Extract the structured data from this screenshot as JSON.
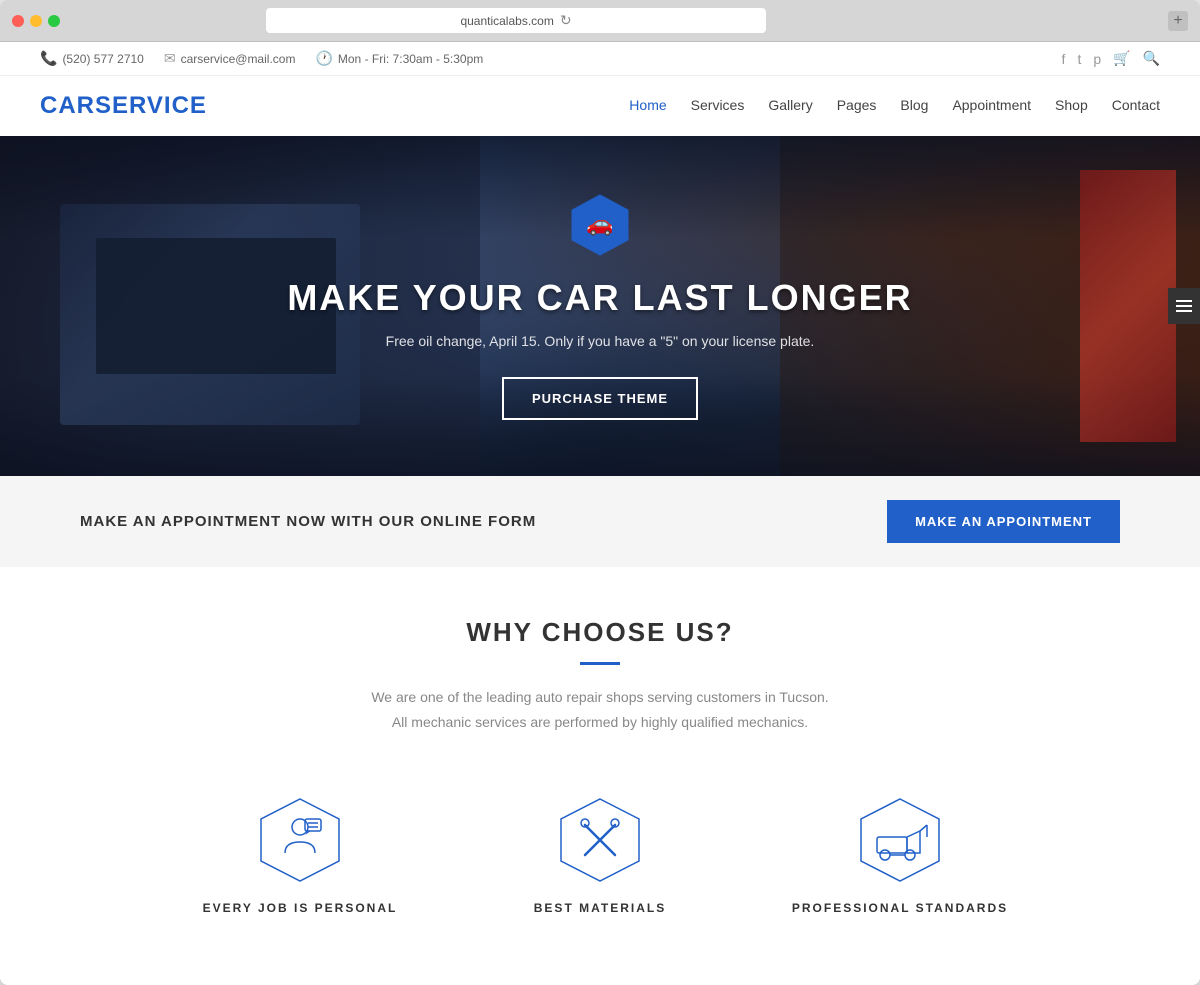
{
  "browser": {
    "url": "quanticalabs.com",
    "new_tab_label": "+"
  },
  "topbar": {
    "phone": "(520) 577 2710",
    "email": "carservice@mail.com",
    "hours": "Mon - Fri: 7:30am - 5:30pm"
  },
  "navbar": {
    "logo": "CARSERVICE",
    "links": [
      {
        "label": "Home",
        "active": true
      },
      {
        "label": "Services",
        "active": false
      },
      {
        "label": "Gallery",
        "active": false
      },
      {
        "label": "Pages",
        "active": false
      },
      {
        "label": "Blog",
        "active": false
      },
      {
        "label": "Appointment",
        "active": false
      },
      {
        "label": "Shop",
        "active": false
      },
      {
        "label": "Contact",
        "active": false
      }
    ]
  },
  "hero": {
    "title": "MAKE YOUR CAR LAST LONGER",
    "subtitle": "Free oil change, April 15. Only if you have a \"5\" on your license plate.",
    "cta_label": "PURCHASE THEME"
  },
  "appointment_banner": {
    "text": "MAKE AN APPOINTMENT NOW WITH OUR ONLINE FORM",
    "button_label": "MAKE AN APPOINTMENT"
  },
  "why_section": {
    "title": "WHY CHOOSE US?",
    "description_line1": "We are one of the leading auto repair shops serving customers in Tucson.",
    "description_line2": "All mechanic services are performed by highly qualified mechanics.",
    "features": [
      {
        "label": "EVERY JOB IS PERSONAL",
        "icon": "person-chat"
      },
      {
        "label": "BEST MATERIALS",
        "icon": "tools-cross"
      },
      {
        "label": "PROFESSIONAL STANDARDS",
        "icon": "tow-truck"
      }
    ]
  }
}
